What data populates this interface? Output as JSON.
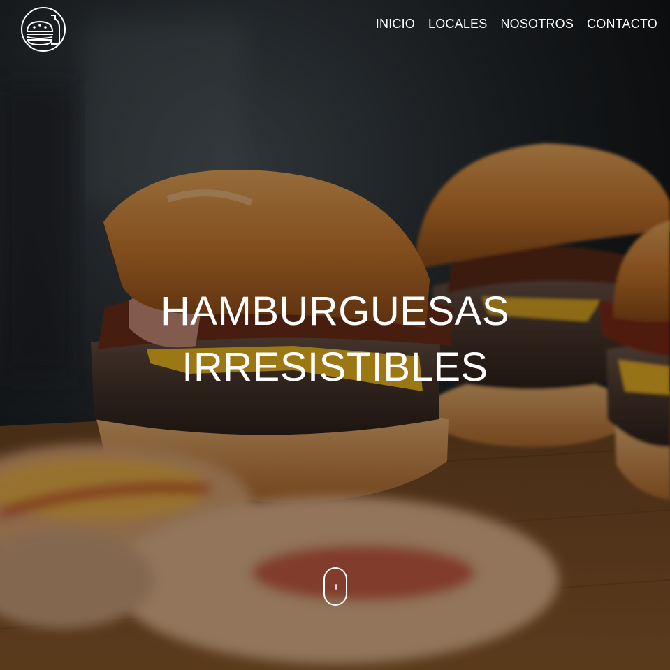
{
  "brand": {
    "logo_icon": "burger-bottle-icon"
  },
  "nav": {
    "items": [
      {
        "label": "INICIO"
      },
      {
        "label": "LOCALES"
      },
      {
        "label": "NOSOTROS"
      },
      {
        "label": "CONTACTO"
      }
    ]
  },
  "hero": {
    "headline_line1": "HAMBURGUESAS",
    "headline_line2": "IRRESISTIBLES",
    "background_image": "burgers-on-wooden-board",
    "scroll_icon": "mouse-scroll-icon"
  },
  "colors": {
    "text": "#ffffff",
    "overlay": "#000000"
  }
}
